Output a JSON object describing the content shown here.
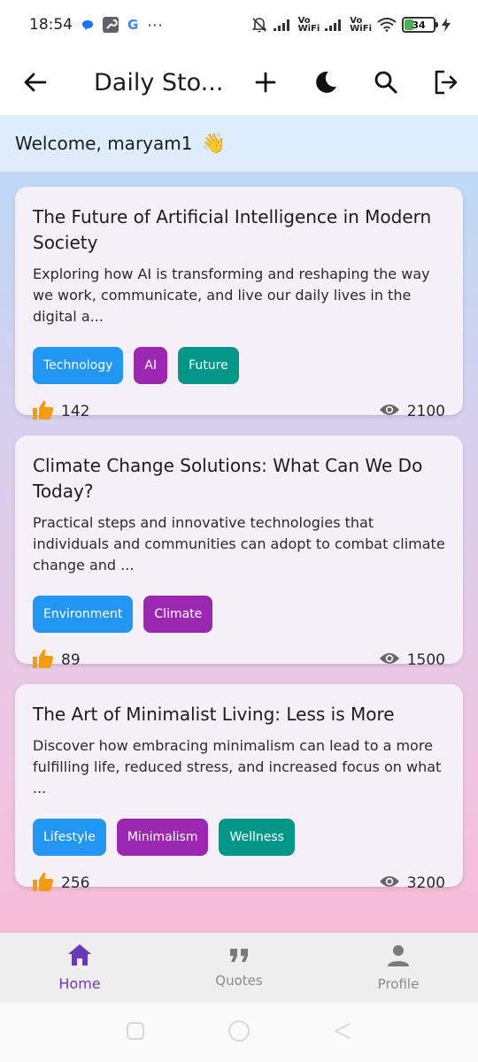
{
  "status_bar": {
    "time": "18:54",
    "wifi_label_1": "Vo",
    "wifi_label_1b": "WiFi",
    "wifi_label_2": "Vo",
    "wifi_label_2b": "WiFi",
    "battery": "34",
    "icons": [
      "chat-bubble-icon",
      "wrench-icon",
      "google-icon",
      "more-dots-icon",
      "mute-bell-icon",
      "signal-icon",
      "wifi-icon",
      "battery-icon",
      "charging-icon"
    ]
  },
  "app_bar": {
    "title": "Daily Sto...",
    "icons": [
      "back-arrow-icon",
      "add-icon",
      "dark-mode-icon",
      "search-icon",
      "logout-icon"
    ]
  },
  "welcome": {
    "text": "Welcome, maryam1",
    "emoji": "👋"
  },
  "stories": [
    {
      "title": "The Future of Artificial Intelligence in Modern Society",
      "description": "Exploring how AI is transforming and reshaping the way we work, communicate, and live our daily lives in the digital a...",
      "tags": [
        {
          "label": "Technology",
          "color": "#2196f3"
        },
        {
          "label": "AI",
          "color": "#9c27b0"
        },
        {
          "label": "Future",
          "color": "#009688"
        }
      ],
      "likes": "142",
      "views": "2100"
    },
    {
      "title": "Climate Change Solutions: What Can We Do Today?",
      "description": "Practical steps and innovative technologies that individuals and communities can adopt to combat climate change and ...",
      "tags": [
        {
          "label": "Environment",
          "color": "#2196f3"
        },
        {
          "label": "Climate",
          "color": "#9c27b0"
        }
      ],
      "likes": "89",
      "views": "1500"
    },
    {
      "title": "The Art of Minimalist Living: Less is More",
      "description": "Discover how embracing minimalism can lead to a more fulfilling life, reduced stress, and increased focus on what ...",
      "tags": [
        {
          "label": "Lifestyle",
          "color": "#2196f3"
        },
        {
          "label": "Minimalism",
          "color": "#9c27b0"
        },
        {
          "label": "Wellness",
          "color": "#009688"
        }
      ],
      "likes": "256",
      "views": "3200"
    }
  ],
  "bottom_nav": {
    "items": [
      {
        "label": "Home",
        "icon": "home-icon",
        "active": true
      },
      {
        "label": "Quotes",
        "icon": "quote-icon",
        "active": false
      },
      {
        "label": "Profile",
        "icon": "person-icon",
        "active": false
      }
    ]
  },
  "colors": {
    "accent": "#673ab7",
    "like": "#f39c12",
    "tag_blue": "#2196f3",
    "tag_purple": "#9c27b0",
    "tag_teal": "#009688"
  }
}
